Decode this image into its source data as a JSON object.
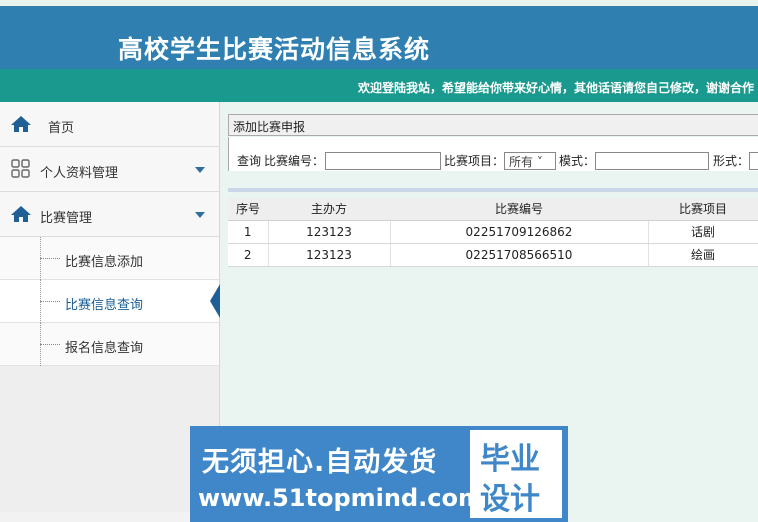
{
  "header": {
    "title": "高校学生比赛活动信息系统",
    "marquee": "欢迎登陆我站，希望能给你带来好心情，其他话语请您自己修改，谢谢合作"
  },
  "sidebar": {
    "items": [
      {
        "label": "首页",
        "icon": "home-icon"
      },
      {
        "label": "个人资料管理",
        "icon": "grid-icon"
      },
      {
        "label": "比赛管理",
        "icon": "home-icon"
      }
    ],
    "sub_items": [
      {
        "label": "比赛信息添加"
      },
      {
        "label": "比赛信息查询"
      },
      {
        "label": "报名信息查询"
      }
    ],
    "active_sub_item": "比赛信息查询"
  },
  "main": {
    "panel_title": "添加比赛申报",
    "search": {
      "query_label": "查询",
      "code_label": "比赛编号：",
      "code_value": "",
      "item_label": "比赛项目：",
      "item_selected": "所有",
      "mode_label": "模式：",
      "mode_value": "",
      "form_label": "形式："
    },
    "table": {
      "headers": [
        "序号",
        "主办方",
        "比赛编号",
        "比赛项目"
      ],
      "rows": [
        [
          "1",
          "123123",
          "02251709126862",
          "话剧"
        ],
        [
          "2",
          "123123",
          "02251708566510",
          "绘画"
        ]
      ]
    }
  },
  "banner": {
    "line1": "无须担心.自动发货",
    "line2": "www.51topmind.com",
    "box_line1": "毕业",
    "box_line2": "设计"
  },
  "colors": {
    "header_bg": "#2f7fb0",
    "marquee_bg": "#1a9a8e",
    "accent": "#1f5f96",
    "banner_bg": "#3f87c8"
  }
}
